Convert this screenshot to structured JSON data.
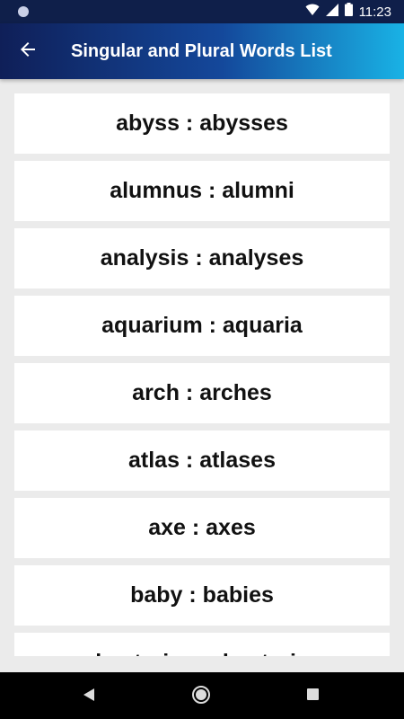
{
  "status_bar": {
    "time": "11:23",
    "icons": [
      "notification-dot-icon",
      "wifi-icon",
      "signal-icon",
      "battery-icon"
    ]
  },
  "app_bar": {
    "title": "Singular and Plural Words List",
    "back_icon": "arrow-left-icon",
    "gradient_colors": [
      "#0f1f58",
      "#14489b",
      "#19b2e5"
    ]
  },
  "list": {
    "items": [
      "abyss : abysses",
      "alumnus : alumni",
      "analysis : analyses",
      "aquarium : aquaria",
      "arch : arches",
      "atlas : atlases",
      "axe : axes",
      "baby : babies",
      "bacterium : bacteria"
    ]
  },
  "nav_bar": {
    "buttons": [
      "back-triangle-icon",
      "home-circle-icon",
      "recents-square-icon"
    ]
  }
}
